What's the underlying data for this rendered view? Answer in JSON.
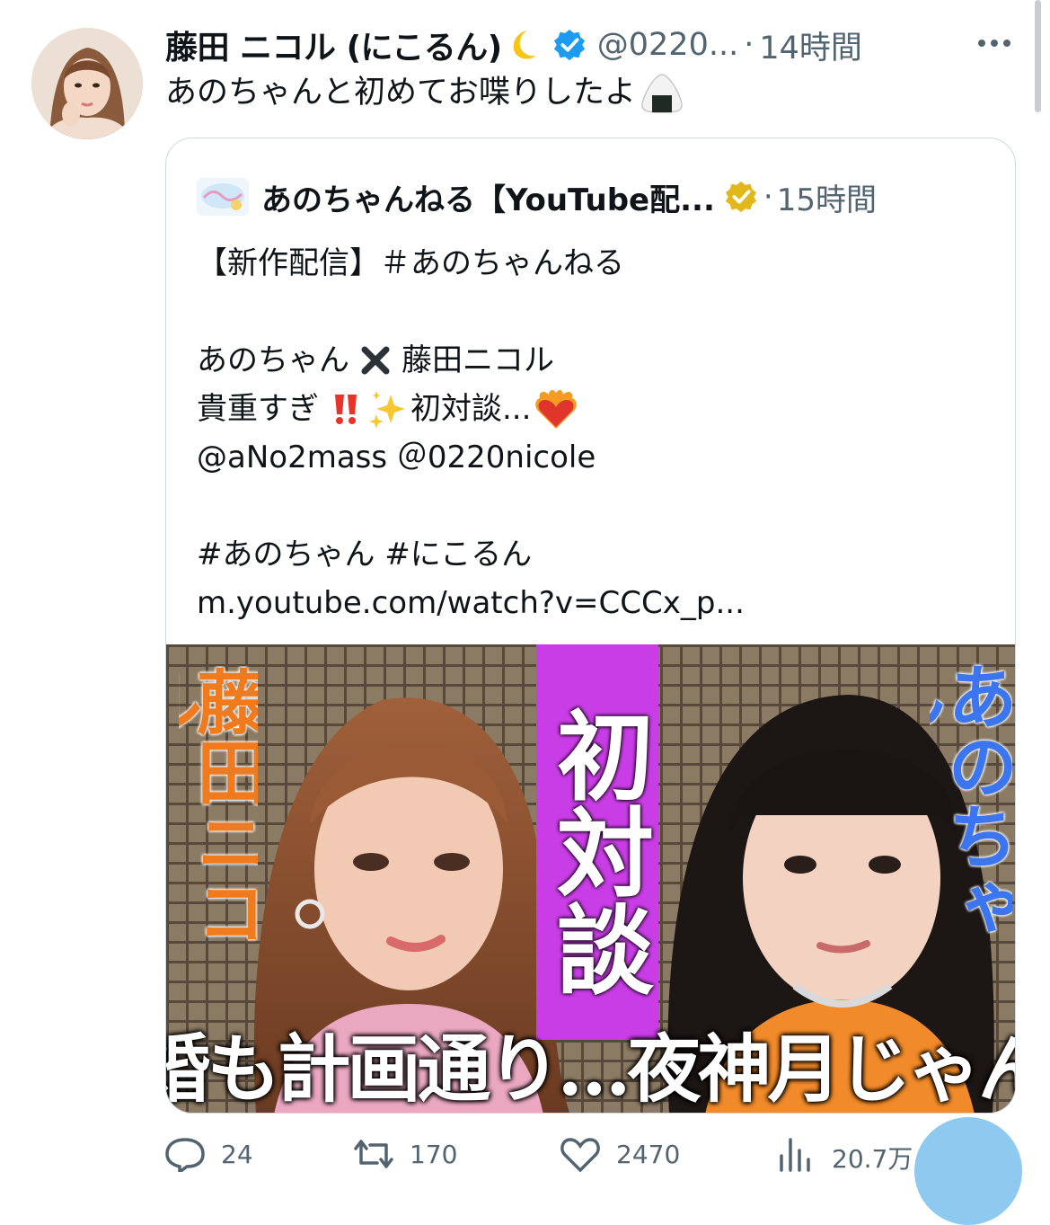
{
  "tweet": {
    "display_name": "藤田 ニコル (にこるん)",
    "handle": "@0220...",
    "separator": "·",
    "time": "14時間",
    "text": "あのちゃんと初めてお喋りしたよ"
  },
  "quote": {
    "name": "あのちゃんねる【YouTube配...",
    "separator": "·",
    "time": "15時間",
    "line1": "【新作配信】＃あのちゃんねる",
    "line2a": "あのちゃん",
    "line2b": "藤田ニコル",
    "line3a": "貴重すぎ",
    "line3b": "初対談...",
    "line4": "@aNo2mass ＠0220nicole",
    "line5": "#あのちゃん  #にこるん",
    "line6": "m.youtube.com/watch?v=CCCx_p..."
  },
  "thumbnail": {
    "left_name": "藤田ニコル",
    "center_title": "初対談",
    "right_name": "あのちゃん",
    "caption": "結婚も計画通り…夜神月じゃん!?"
  },
  "actions": {
    "reply_count": "24",
    "retweet_count": "170",
    "like_count": "2470",
    "views_count": "20.7万"
  },
  "colors": {
    "accent": "#1d9bf0",
    "gold": "#e2b719",
    "magenta": "#c93de6",
    "orange": "#f07a1e"
  }
}
